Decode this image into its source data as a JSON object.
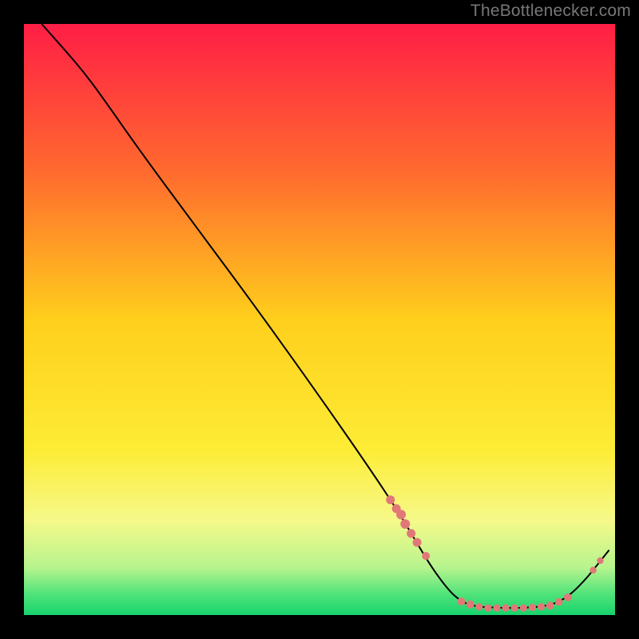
{
  "watermark_text": "TheBottlenecker.com",
  "chart_data": {
    "type": "line",
    "title": "",
    "xlabel": "",
    "ylabel": "",
    "xlim": [
      0,
      100
    ],
    "ylim": [
      0,
      100
    ],
    "grid": false,
    "gradient_stops": [
      {
        "offset": 0.0,
        "color": "#ff1e46"
      },
      {
        "offset": 0.25,
        "color": "#ff6a2e"
      },
      {
        "offset": 0.5,
        "color": "#ffcf1c"
      },
      {
        "offset": 0.72,
        "color": "#fdec35"
      },
      {
        "offset": 0.84,
        "color": "#f6f98a"
      },
      {
        "offset": 0.92,
        "color": "#b6f48e"
      },
      {
        "offset": 0.965,
        "color": "#4fe37a"
      },
      {
        "offset": 1.0,
        "color": "#17d36c"
      }
    ],
    "curve": [
      {
        "x": 3.0,
        "y": 100.0
      },
      {
        "x": 7.0,
        "y": 95.5
      },
      {
        "x": 10.0,
        "y": 92.0
      },
      {
        "x": 13.0,
        "y": 88.0
      },
      {
        "x": 20.0,
        "y": 78.0
      },
      {
        "x": 30.0,
        "y": 64.5
      },
      {
        "x": 40.0,
        "y": 51.0
      },
      {
        "x": 50.0,
        "y": 37.0
      },
      {
        "x": 58.0,
        "y": 25.5
      },
      {
        "x": 63.0,
        "y": 18.0
      },
      {
        "x": 66.0,
        "y": 13.0
      },
      {
        "x": 69.0,
        "y": 8.0
      },
      {
        "x": 72.0,
        "y": 4.0
      },
      {
        "x": 74.0,
        "y": 2.3
      },
      {
        "x": 76.0,
        "y": 1.5
      },
      {
        "x": 80.0,
        "y": 1.2
      },
      {
        "x": 85.0,
        "y": 1.2
      },
      {
        "x": 89.0,
        "y": 1.6
      },
      {
        "x": 92.0,
        "y": 3.0
      },
      {
        "x": 95.0,
        "y": 6.0
      },
      {
        "x": 97.0,
        "y": 8.5
      },
      {
        "x": 99.0,
        "y": 11.0
      }
    ],
    "marker_points": [
      {
        "x": 62.0,
        "y": 19.5,
        "r": 5.5
      },
      {
        "x": 63.0,
        "y": 18.0,
        "r": 5.5
      },
      {
        "x": 63.8,
        "y": 17.0,
        "r": 6.0
      },
      {
        "x": 64.5,
        "y": 15.4,
        "r": 6.0
      },
      {
        "x": 65.5,
        "y": 13.8,
        "r": 5.5
      },
      {
        "x": 66.5,
        "y": 12.3,
        "r": 5.5
      },
      {
        "x": 68.0,
        "y": 10.0,
        "r": 5.0
      },
      {
        "x": 74.0,
        "y": 2.3,
        "r": 5.0
      },
      {
        "x": 75.5,
        "y": 1.8,
        "r": 5.0
      },
      {
        "x": 77.0,
        "y": 1.4,
        "r": 4.6
      },
      {
        "x": 78.5,
        "y": 1.2,
        "r": 4.6
      },
      {
        "x": 80.0,
        "y": 1.2,
        "r": 4.6
      },
      {
        "x": 81.5,
        "y": 1.2,
        "r": 4.6
      },
      {
        "x": 83.0,
        "y": 1.2,
        "r": 4.6
      },
      {
        "x": 84.5,
        "y": 1.2,
        "r": 4.6
      },
      {
        "x": 86.0,
        "y": 1.3,
        "r": 4.6
      },
      {
        "x": 87.5,
        "y": 1.4,
        "r": 4.6
      },
      {
        "x": 89.0,
        "y": 1.6,
        "r": 5.0
      },
      {
        "x": 90.5,
        "y": 2.2,
        "r": 4.8
      },
      {
        "x": 92.0,
        "y": 3.0,
        "r": 4.8
      },
      {
        "x": 96.3,
        "y": 7.6,
        "r": 4.2
      },
      {
        "x": 97.5,
        "y": 9.2,
        "r": 4.2
      }
    ],
    "marker_color": "#e17878",
    "curve_color": "#000000",
    "flat_label": {
      "text": "",
      "x": 81,
      "y": 1.2
    }
  }
}
